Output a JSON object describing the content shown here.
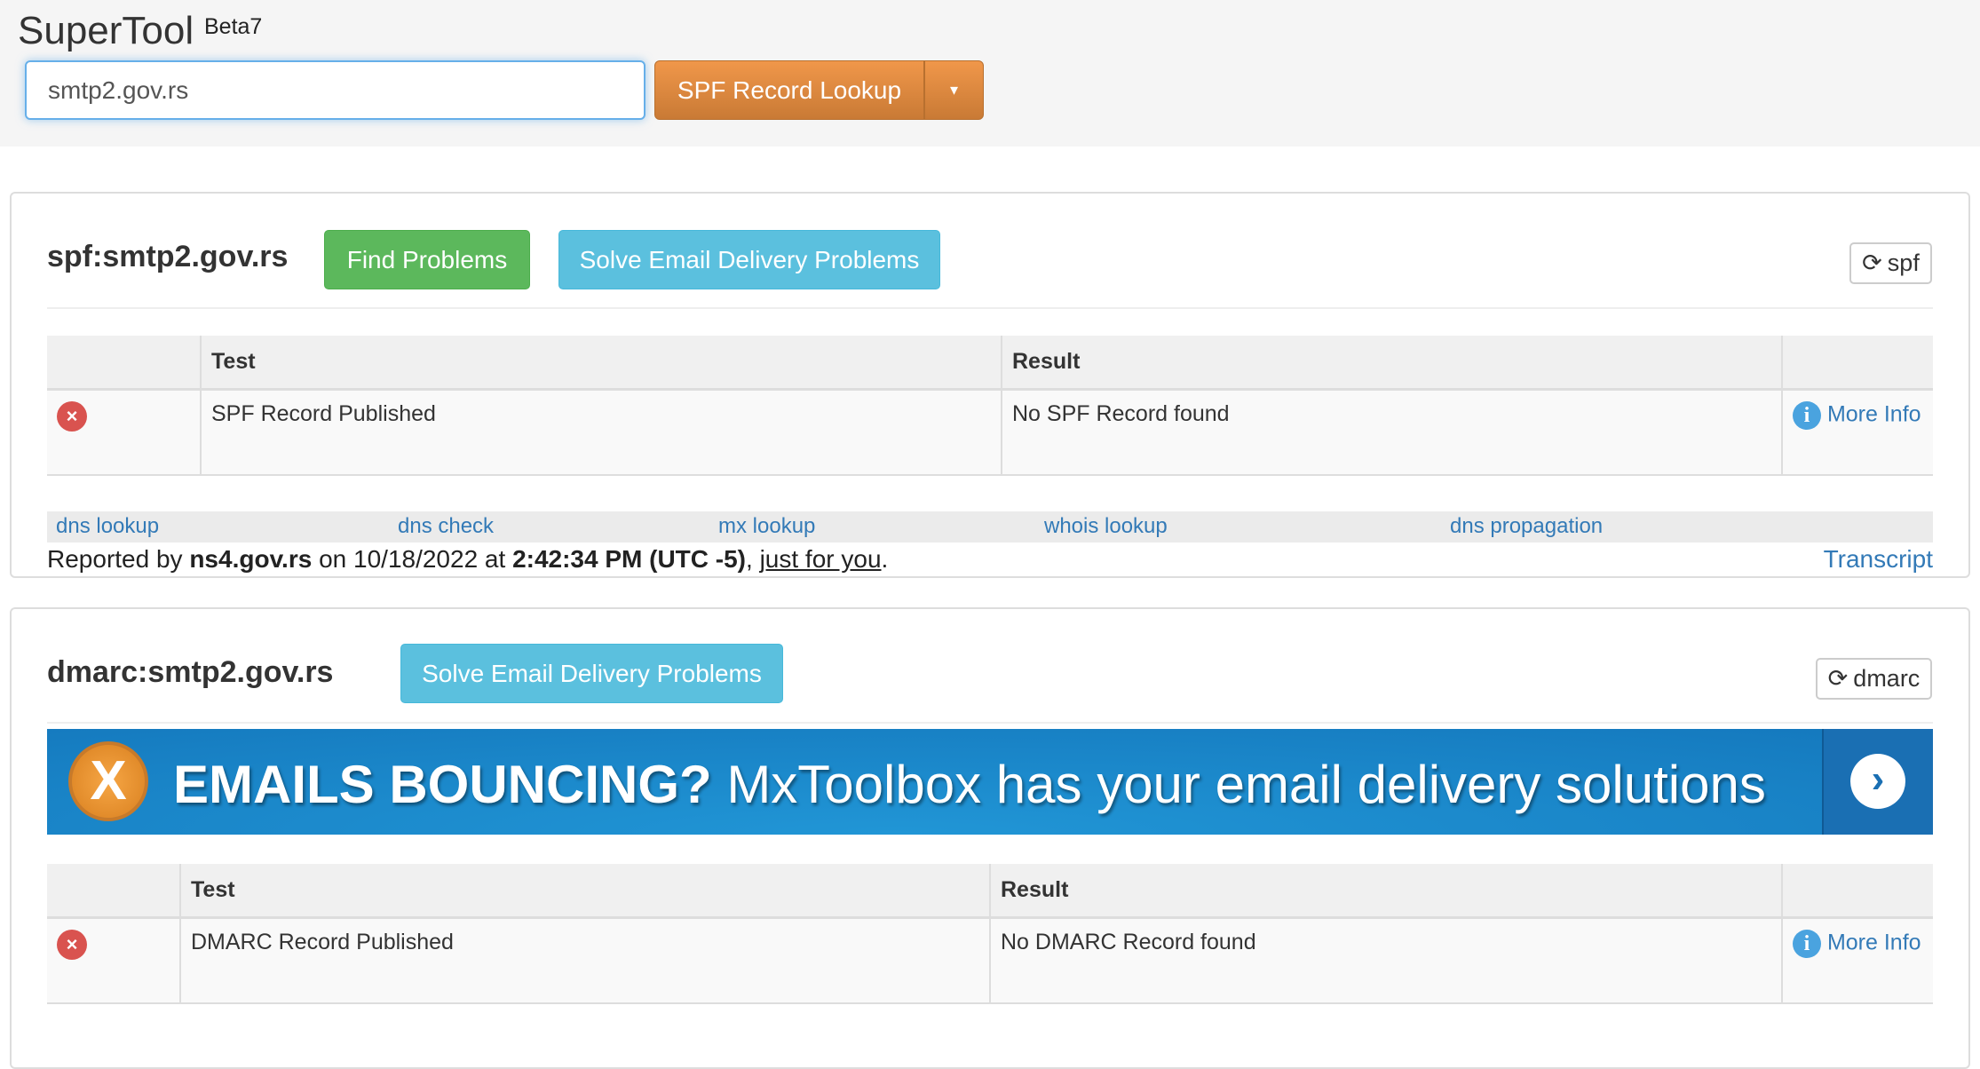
{
  "header": {
    "title": "SuperTool",
    "badge": "Beta7",
    "search_value": "smtp2.gov.rs",
    "lookup_label": "SPF Record Lookup",
    "caret": "▾"
  },
  "spf": {
    "heading": "spf:smtp2.gov.rs",
    "find_problems": "Find Problems",
    "solve": "Solve Email Delivery Problems",
    "refresh": "spf",
    "columns": [
      "",
      "Test",
      "Result",
      ""
    ],
    "rows": [
      {
        "status": "error",
        "test": "SPF Record Published",
        "result": "No SPF Record found",
        "more": "More Info"
      }
    ],
    "links": [
      "dns lookup",
      "dns check",
      "mx lookup",
      "whois lookup",
      "dns propagation"
    ],
    "reported": {
      "prefix": "Reported by ",
      "server": "ns4.gov.rs",
      "on": " on 10/18/2022 at ",
      "time": "2:42:34 PM (UTC -5)",
      "comma": ", ",
      "just": "just for you",
      "dot": "."
    },
    "transcript": "Transcript"
  },
  "dmarc": {
    "heading": "dmarc:smtp2.gov.rs",
    "solve": "Solve Email Delivery Problems",
    "refresh": "dmarc",
    "banner": {
      "bold": "EMAILS BOUNCING?",
      "text": " MxToolbox has your email delivery solutions",
      "logo": "X"
    },
    "columns": [
      "",
      "Test",
      "Result",
      ""
    ],
    "rows": [
      {
        "status": "error",
        "test": "DMARC Record Published",
        "result": "No DMARC Record found",
        "more": "More Info"
      }
    ]
  },
  "colors": {
    "accent": "#f0974a",
    "success": "#5cb85c",
    "info": "#5bc0de",
    "error": "#d9534f",
    "link": "#337ab7"
  }
}
